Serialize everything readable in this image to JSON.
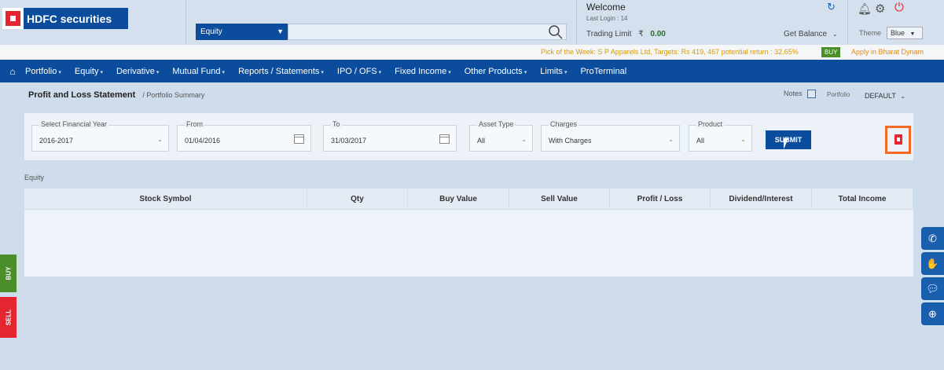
{
  "header": {
    "logo_text": "HDFC securities",
    "search_select": "Equity",
    "welcome": "Welcome",
    "last_login": "Last Login : 14",
    "trading_limit_label": "Trading Limit",
    "currency": "₹",
    "trading_limit_value": "0.00",
    "get_balance": "Get Balance",
    "theme_label": "Theme",
    "theme_value": "Blue"
  },
  "ticker": {
    "text": "Pick of the Week: S P Apparels Ltd, Targets: Rs 419, 467 potential return : 32.65%",
    "badge": "BUY",
    "action": "Apply in Bharat Dynam"
  },
  "nav": {
    "items": [
      {
        "label": "Portfolio",
        "caret": true
      },
      {
        "label": "Equity",
        "caret": true
      },
      {
        "label": "Derivative",
        "caret": true
      },
      {
        "label": "Mutual Fund",
        "caret": true
      },
      {
        "label": "Reports / Statements",
        "caret": true
      },
      {
        "label": "IPO / OFS",
        "caret": true
      },
      {
        "label": "Fixed Income",
        "caret": true
      },
      {
        "label": "Other Products",
        "caret": true
      },
      {
        "label": "Limits",
        "caret": true
      },
      {
        "label": "ProTerminal",
        "caret": false
      }
    ]
  },
  "page": {
    "title": "Profit and Loss Statement",
    "breadcrumb": "/ Portfolio Summary",
    "notes": "Notes",
    "portfolio_label": "Portfolio",
    "portfolio_value": "DEFAULT"
  },
  "filters": {
    "financial_year": {
      "label": "Select Financial Year",
      "value": "2016-2017"
    },
    "from": {
      "label": "From",
      "value": "01/04/2016"
    },
    "to": {
      "label": "To",
      "value": "31/03/2017"
    },
    "asset_type": {
      "label": "Asset Type",
      "value": "All"
    },
    "charges": {
      "label": "Charges",
      "value": "With Charges"
    },
    "product": {
      "label": "Product",
      "value": "All"
    },
    "submit": "SUBMIT"
  },
  "section_label": "Equity",
  "table": {
    "columns": [
      "Stock Symbol",
      "Qty",
      "Buy Value",
      "Sell Value",
      "Profit / Loss",
      "Dividend/Interest",
      "Total Income"
    ]
  },
  "side": {
    "buy": "BUY",
    "sell": "SELL"
  },
  "colors": {
    "brand_blue": "#0b4d9c",
    "red": "#e3262f",
    "green": "#4a8f2a",
    "highlight": "#f36a27"
  }
}
